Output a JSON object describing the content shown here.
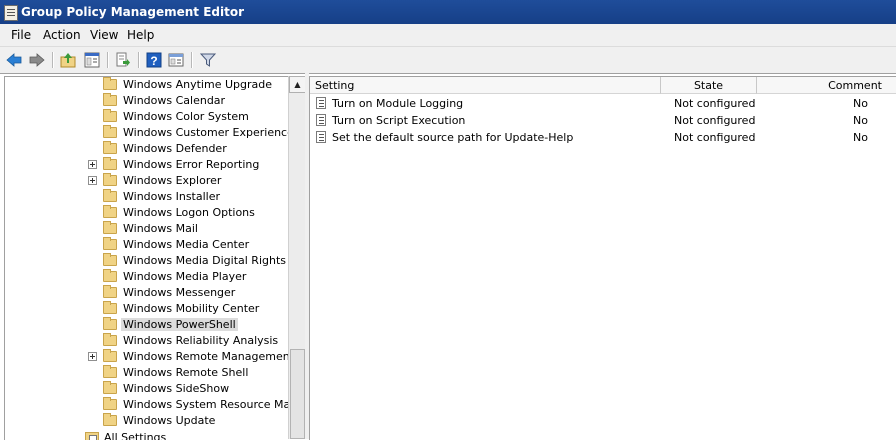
{
  "window": {
    "title": "Group Policy Management Editor"
  },
  "menu": [
    "File",
    "Action",
    "View",
    "Help"
  ],
  "toolbar": {
    "icons": [
      "back-arrow-icon",
      "forward-arrow-icon",
      "up-folder-icon",
      "show-hide-tree-icon",
      "export-list-icon",
      "help-icon",
      "properties-icon",
      "filter-icon"
    ],
    "colors": {
      "back": "#2a7fd4",
      "forward": "#6b6b6b",
      "help": "#1f5fbf"
    }
  },
  "tree": {
    "items": [
      {
        "label": "Windows Anytime Upgrade",
        "expandable": false,
        "selected": false
      },
      {
        "label": "Windows Calendar",
        "expandable": false,
        "selected": false
      },
      {
        "label": "Windows Color System",
        "expandable": false,
        "selected": false
      },
      {
        "label": "Windows Customer Experience Im",
        "expandable": false,
        "selected": false
      },
      {
        "label": "Windows Defender",
        "expandable": false,
        "selected": false
      },
      {
        "label": "Windows Error Reporting",
        "expandable": true,
        "selected": false
      },
      {
        "label": "Windows Explorer",
        "expandable": true,
        "selected": false
      },
      {
        "label": "Windows Installer",
        "expandable": false,
        "selected": false
      },
      {
        "label": "Windows Logon Options",
        "expandable": false,
        "selected": false
      },
      {
        "label": "Windows Mail",
        "expandable": false,
        "selected": false
      },
      {
        "label": "Windows Media Center",
        "expandable": false,
        "selected": false
      },
      {
        "label": "Windows Media Digital Rights Mana",
        "expandable": false,
        "selected": false
      },
      {
        "label": "Windows Media Player",
        "expandable": false,
        "selected": false
      },
      {
        "label": "Windows Messenger",
        "expandable": false,
        "selected": false
      },
      {
        "label": "Windows Mobility Center",
        "expandable": false,
        "selected": false
      },
      {
        "label": "Windows PowerShell",
        "expandable": false,
        "selected": true
      },
      {
        "label": "Windows Reliability Analysis",
        "expandable": false,
        "selected": false
      },
      {
        "label": "Windows Remote Management (W",
        "expandable": true,
        "selected": false
      },
      {
        "label": "Windows Remote Shell",
        "expandable": false,
        "selected": false
      },
      {
        "label": "Windows SideShow",
        "expandable": false,
        "selected": false
      },
      {
        "label": "Windows System Resource Manag",
        "expandable": false,
        "selected": false
      },
      {
        "label": "Windows Update",
        "expandable": false,
        "selected": false
      }
    ],
    "all_settings": "All Settings"
  },
  "list": {
    "columns": {
      "setting": "Setting",
      "state": "State",
      "comment": "Comment"
    },
    "rows": [
      {
        "setting": "Turn on Module Logging",
        "state": "Not configured",
        "comment": "No"
      },
      {
        "setting": "Turn on Script Execution",
        "state": "Not configured",
        "comment": "No"
      },
      {
        "setting": "Set the default source path for Update-Help",
        "state": "Not configured",
        "comment": "No"
      }
    ]
  }
}
